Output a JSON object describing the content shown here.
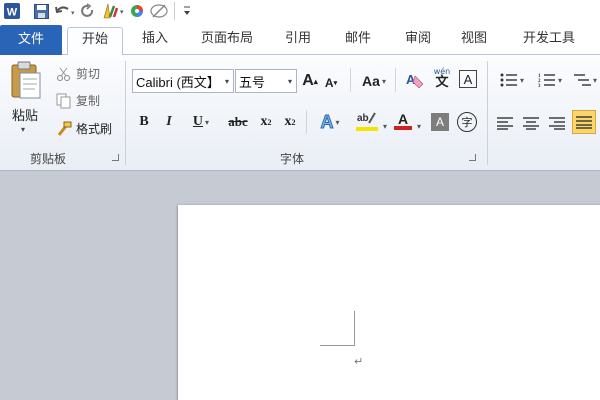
{
  "app": {
    "logo": "W"
  },
  "quick_access": [
    "word-logo-icon",
    "save-icon",
    "undo-icon",
    "redo-icon",
    "customize-icon",
    "color-icon",
    "eraser-icon",
    "qat-more-icon"
  ],
  "tabs": [
    "文件",
    "开始",
    "插入",
    "页面布局",
    "引用",
    "邮件",
    "审阅",
    "视图",
    "开发工具"
  ],
  "clipboard": {
    "paste": "粘贴",
    "cut": "剪切",
    "copy": "复制",
    "format_painter": "格式刷",
    "group_label": "剪贴板"
  },
  "font": {
    "name": "Calibri (西文】",
    "size": "五号",
    "grow": "A",
    "shrink": "A",
    "change_case": "Aa",
    "phonetic": "wén",
    "bold": "B",
    "italic": "I",
    "underline": "U",
    "strikethrough": "abc",
    "subscript": "x",
    "superscript": "x",
    "sub_mark": "2",
    "sup_mark": "2",
    "text_effect": "A",
    "font_color": "A",
    "char_shading": "A",
    "enclose_char": "字",
    "group_label": "字体"
  },
  "colors": {
    "file_tab": "#2a64b6",
    "highlight": "#f5e400",
    "font_color": "#d21f1f",
    "accent": "#2b579a"
  },
  "document": {
    "paragraph_mark": "↵"
  }
}
